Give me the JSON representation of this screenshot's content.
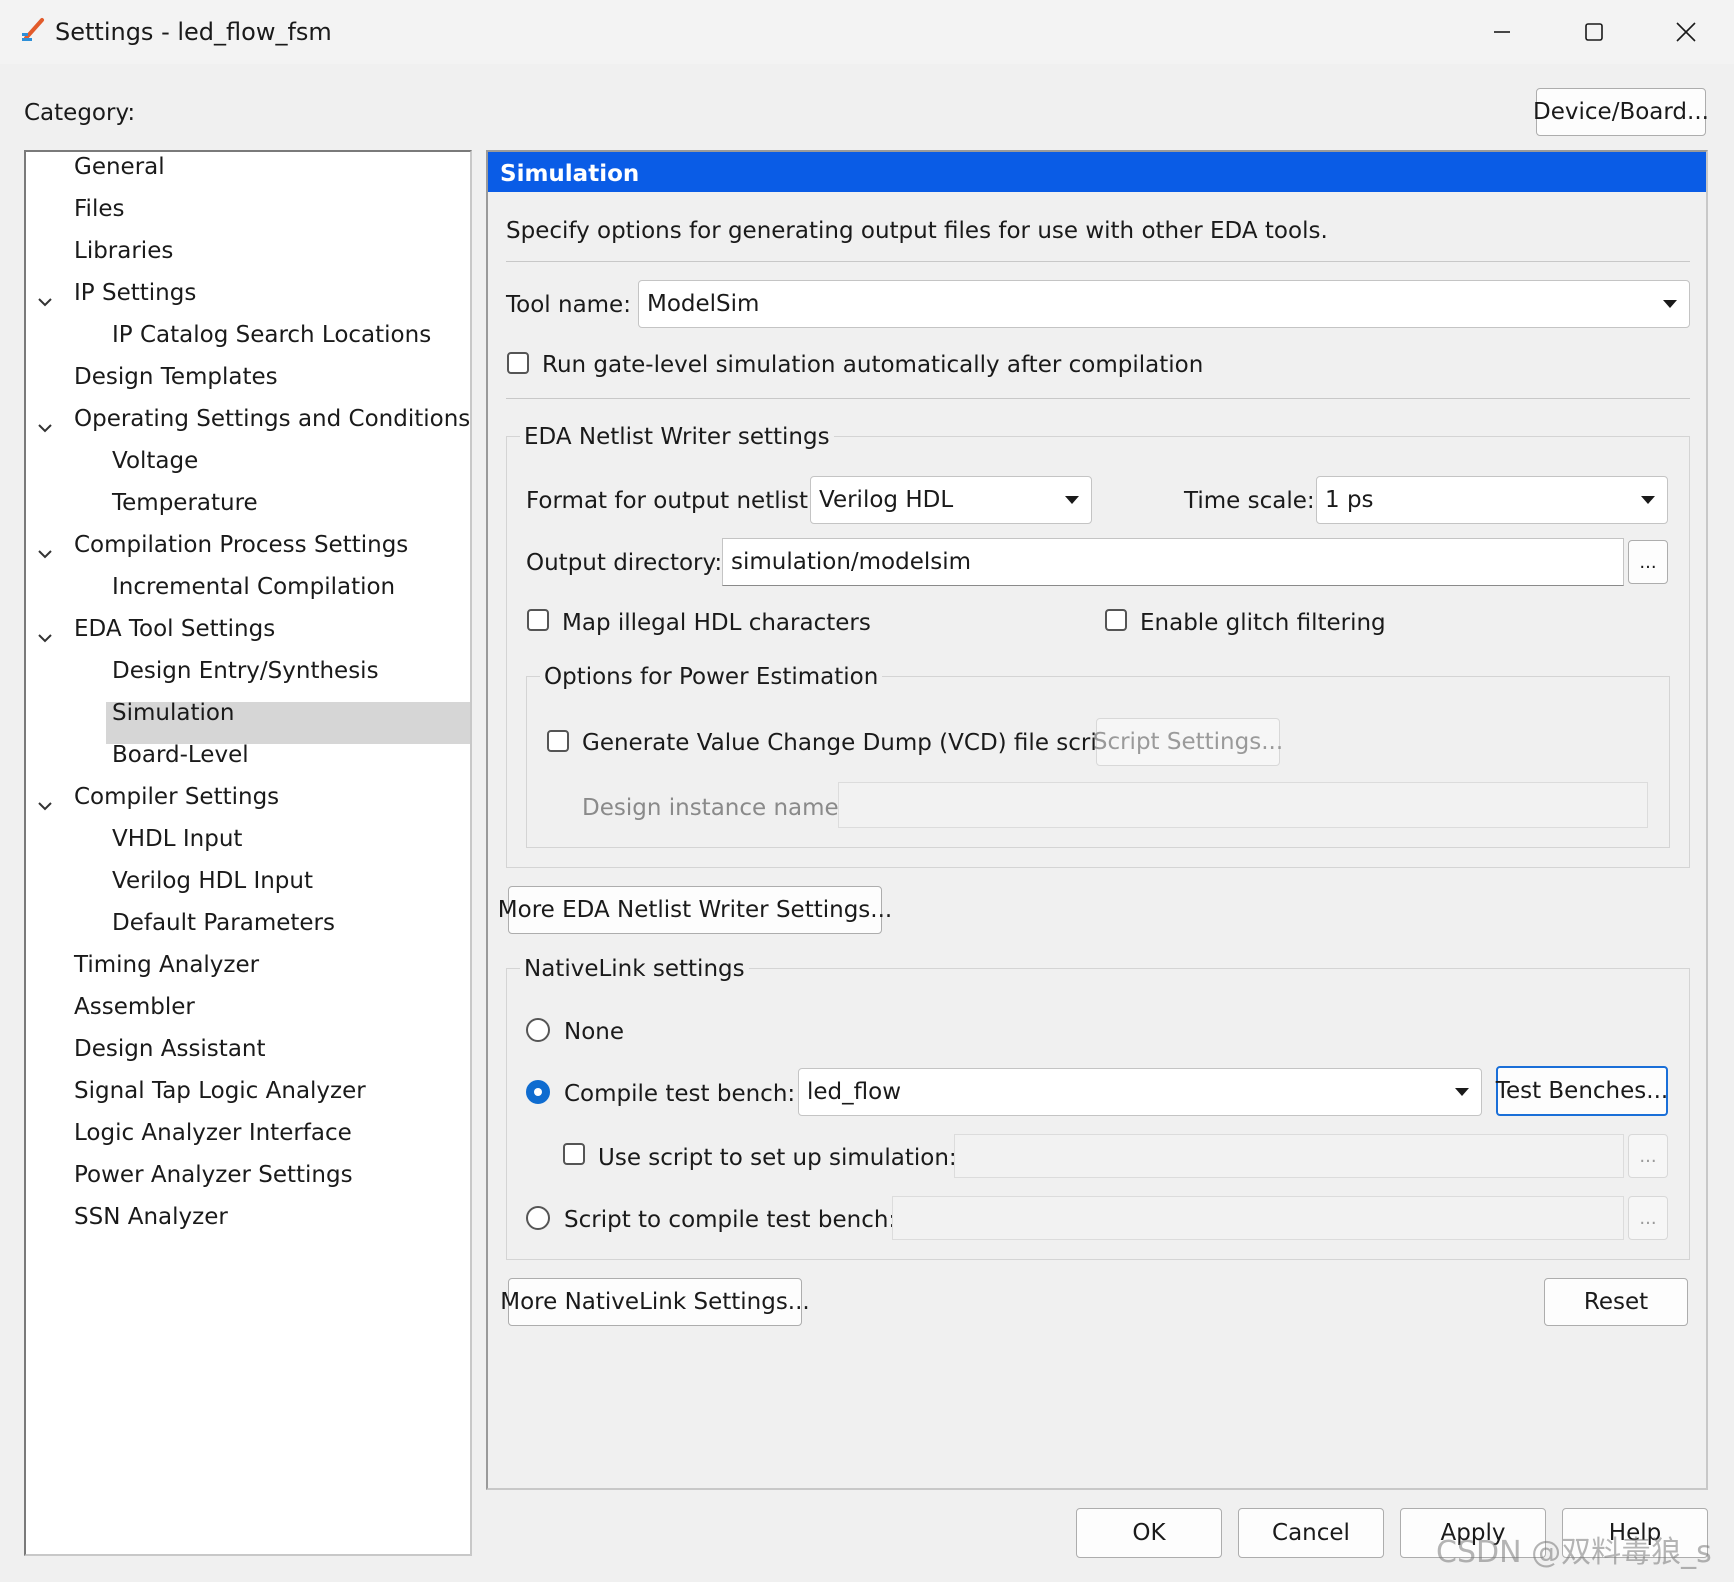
{
  "window": {
    "title": "Settings - led_flow_fsm",
    "icon": "settings-pen-icon"
  },
  "header": {
    "category_label": "Category:",
    "device_board_button": "Device/Board..."
  },
  "sidebar": {
    "items": [
      {
        "label": "General",
        "level": 0,
        "expanded": null
      },
      {
        "label": "Files",
        "level": 0,
        "expanded": null
      },
      {
        "label": "Libraries",
        "level": 0,
        "expanded": null
      },
      {
        "label": "IP Settings",
        "level": 0,
        "expanded": true
      },
      {
        "label": "IP Catalog Search Locations",
        "level": 1,
        "expanded": null
      },
      {
        "label": "Design Templates",
        "level": 0,
        "expanded": null
      },
      {
        "label": "Operating Settings and Conditions",
        "level": 0,
        "expanded": true
      },
      {
        "label": "Voltage",
        "level": 1,
        "expanded": null
      },
      {
        "label": "Temperature",
        "level": 1,
        "expanded": null
      },
      {
        "label": "Compilation Process Settings",
        "level": 0,
        "expanded": true
      },
      {
        "label": "Incremental Compilation",
        "level": 1,
        "expanded": null
      },
      {
        "label": "EDA Tool Settings",
        "level": 0,
        "expanded": true
      },
      {
        "label": "Design Entry/Synthesis",
        "level": 1,
        "expanded": null
      },
      {
        "label": "Simulation",
        "level": 1,
        "expanded": null,
        "selected": true
      },
      {
        "label": "Board-Level",
        "level": 1,
        "expanded": null
      },
      {
        "label": "Compiler Settings",
        "level": 0,
        "expanded": true
      },
      {
        "label": "VHDL Input",
        "level": 1,
        "expanded": null
      },
      {
        "label": "Verilog HDL Input",
        "level": 1,
        "expanded": null
      },
      {
        "label": "Default Parameters",
        "level": 1,
        "expanded": null
      },
      {
        "label": "Timing Analyzer",
        "level": 0,
        "expanded": null
      },
      {
        "label": "Assembler",
        "level": 0,
        "expanded": null
      },
      {
        "label": "Design Assistant",
        "level": 0,
        "expanded": null
      },
      {
        "label": "Signal Tap Logic Analyzer",
        "level": 0,
        "expanded": null
      },
      {
        "label": "Logic Analyzer Interface",
        "level": 0,
        "expanded": null
      },
      {
        "label": "Power Analyzer Settings",
        "level": 0,
        "expanded": null
      },
      {
        "label": "SSN Analyzer",
        "level": 0,
        "expanded": null
      }
    ]
  },
  "panel": {
    "title": "Simulation",
    "title_bg": "#0a5ce6",
    "description": "Specify options for generating output files for use with other EDA tools.",
    "tool_name_label": "Tool name:",
    "tool_name_value": "ModelSim",
    "run_gate_level_label": "Run gate-level simulation automatically after compilation",
    "run_gate_level_checked": false,
    "netlist": {
      "group_label": "EDA Netlist Writer settings",
      "format_label": "Format for output netlist:",
      "format_value": "Verilog HDL",
      "timescale_label": "Time scale:",
      "timescale_value": "1 ps",
      "output_dir_label": "Output directory:",
      "output_dir_value": "simulation/modelsim",
      "browse_label": "...",
      "map_illegal_label": "Map illegal HDL characters",
      "map_illegal_checked": false,
      "glitch_label": "Enable glitch filtering",
      "glitch_checked": false,
      "power": {
        "group_label": "Options for Power Estimation",
        "vcd_label": "Generate Value Change Dump (VCD) file script",
        "vcd_checked": false,
        "script_settings_button": "Script Settings...",
        "instance_label": "Design instance name:",
        "instance_value": ""
      }
    },
    "more_netlist_button": "More EDA Netlist Writer Settings...",
    "nativelink": {
      "group_label": "NativeLink settings",
      "none_label": "None",
      "compile_tb_label": "Compile test bench:",
      "compile_tb_value": "led_flow",
      "test_benches_button": "Test Benches...",
      "use_script_label": "Use script to set up simulation:",
      "use_script_checked": false,
      "script_compile_label": "Script to compile test bench:",
      "browse_label": "...",
      "selected_option": "compile_tb"
    },
    "more_nativelink_button": "More NativeLink Settings...",
    "reset_button": "Reset"
  },
  "footer": {
    "ok": "OK",
    "cancel": "Cancel",
    "apply": "Apply",
    "help": "Help"
  },
  "watermark": "CSDN @双料毒狼_s"
}
